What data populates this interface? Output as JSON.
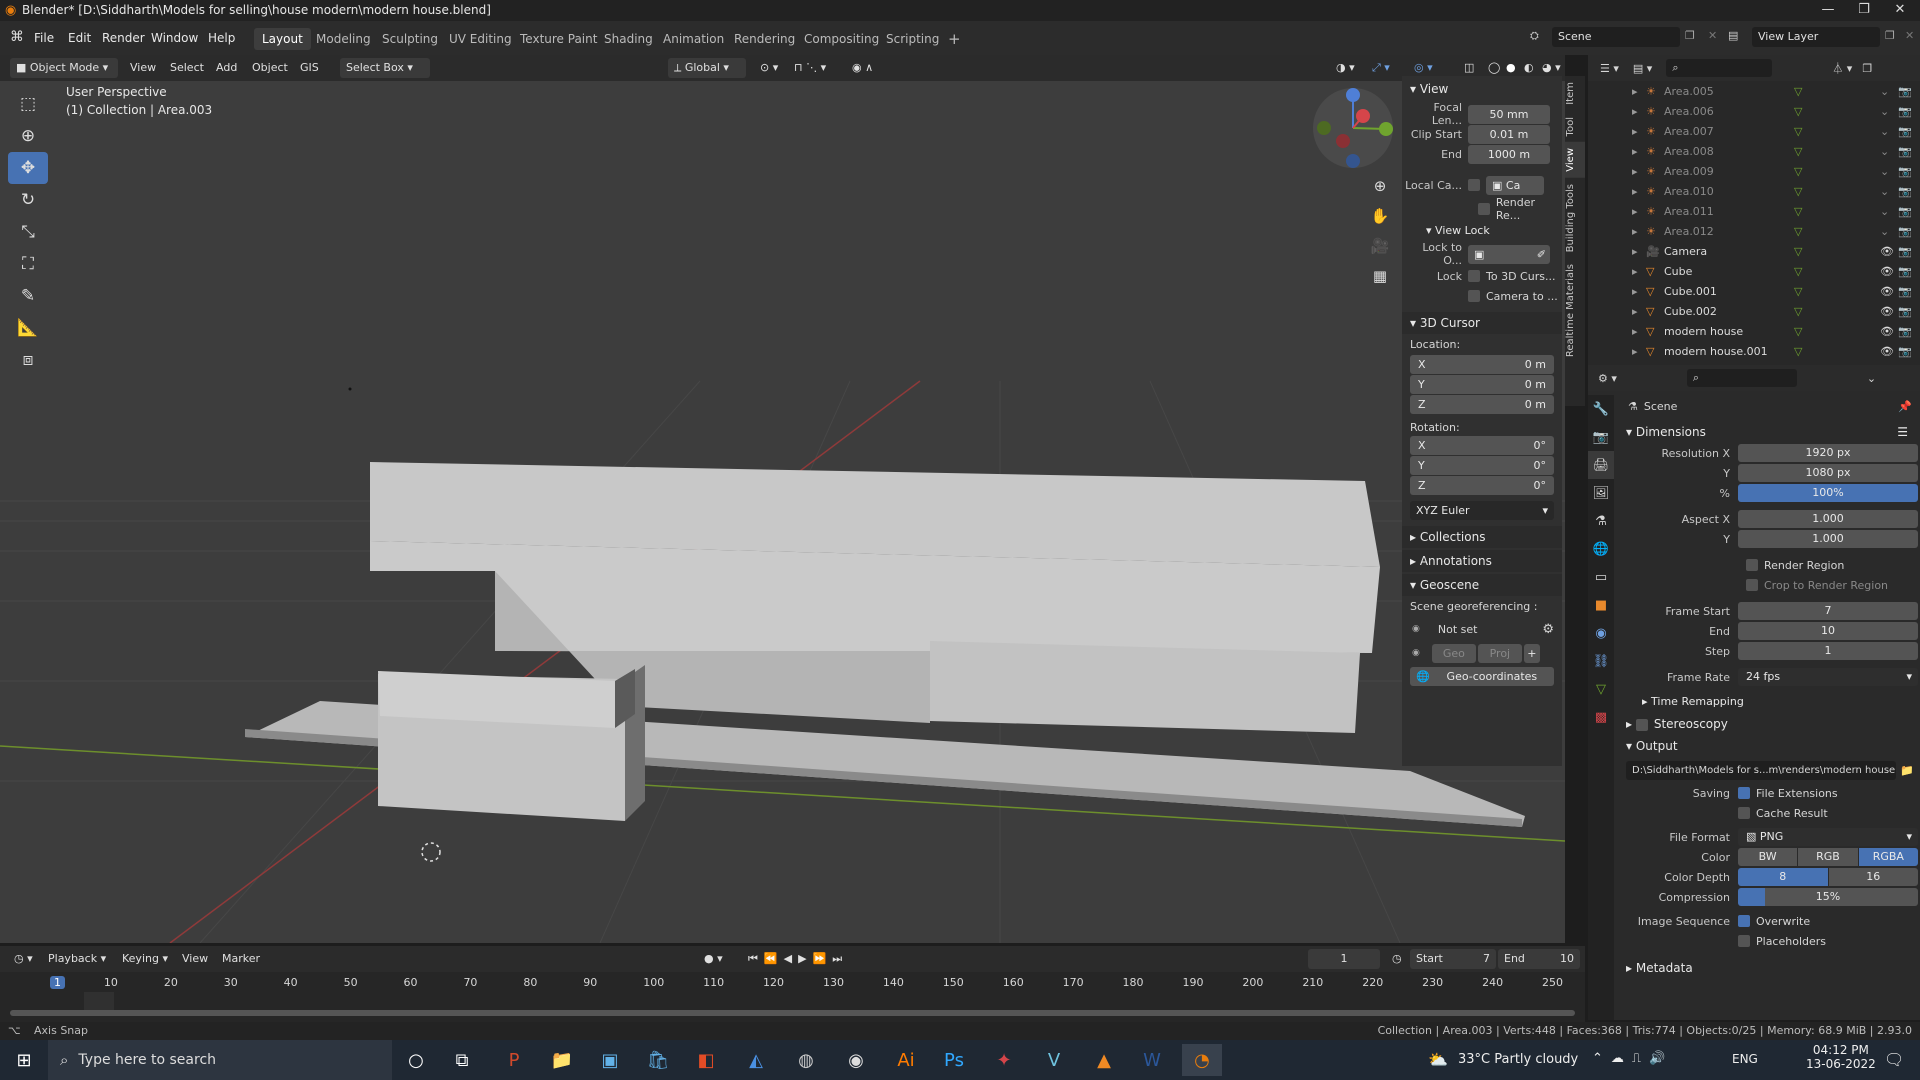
{
  "window": {
    "title": "Blender* [D:\\Siddharth\\Models for selling\\house modern\\modern house.blend]"
  },
  "menu": [
    "File",
    "Edit",
    "Render",
    "Window",
    "Help"
  ],
  "workspaces": [
    "Layout",
    "Modeling",
    "Sculpting",
    "UV Editing",
    "Texture Paint",
    "Shading",
    "Animation",
    "Rendering",
    "Compositing",
    "Scripting"
  ],
  "active_workspace": "Layout",
  "scene_name": "Scene",
  "view_layer": "View Layer",
  "viewport_header": {
    "mode": "Object Mode",
    "menus": [
      "View",
      "Select",
      "Add",
      "Object",
      "GIS"
    ],
    "select_box": "Select Box",
    "transform": "Global"
  },
  "viewport": {
    "perspective": "User Perspective",
    "collection_info": "(1) Collection | Area.003"
  },
  "npanel": {
    "tabs": [
      "Item",
      "Tool",
      "View",
      "Building Tools",
      "Realtime Materials"
    ],
    "view_header": "View",
    "focal_label": "Focal Len...",
    "focal_value": "50 mm",
    "clip_start_label": "Clip Start",
    "clip_start_value": "0.01 m",
    "clip_end_label": "End",
    "clip_end_value": "1000 m",
    "local_camera_label": "Local Ca...",
    "local_camera_value": "Ca",
    "render_region": "Render Re...",
    "view_lock_header": "View Lock",
    "lock_to_label": "Lock to O...",
    "lock_label": "Lock",
    "lock_cursor": "To 3D Curs...",
    "lock_camera": "Camera to ...",
    "cursor_header": "3D Cursor",
    "location_label": "Location:",
    "loc_x": "0 m",
    "loc_y": "0 m",
    "loc_z": "0 m",
    "rotation_label": "Rotation:",
    "rot_x": "0°",
    "rot_y": "0°",
    "rot_z": "0°",
    "rotation_mode": "XYZ Euler",
    "collections": "Collections",
    "annotations": "Annotations",
    "geoscene": "Geoscene",
    "georef_label": "Scene georeferencing :",
    "not_set": "Not set",
    "geo": "Geo",
    "proj": "Proj",
    "geo_coords": "Geo-coordinates"
  },
  "outliner": {
    "items": [
      {
        "name": "Area.005",
        "type": "light",
        "dim": true
      },
      {
        "name": "Area.006",
        "type": "light",
        "dim": true
      },
      {
        "name": "Area.007",
        "type": "light",
        "dim": true
      },
      {
        "name": "Area.008",
        "type": "light",
        "dim": true
      },
      {
        "name": "Area.009",
        "type": "light",
        "dim": true
      },
      {
        "name": "Area.010",
        "type": "light",
        "dim": true
      },
      {
        "name": "Area.011",
        "type": "light",
        "dim": true
      },
      {
        "name": "Area.012",
        "type": "light",
        "dim": true
      },
      {
        "name": "Camera",
        "type": "camera",
        "dim": false
      },
      {
        "name": "Cube",
        "type": "mesh",
        "dim": false
      },
      {
        "name": "Cube.001",
        "type": "mesh",
        "dim": false
      },
      {
        "name": "Cube.002",
        "type": "mesh",
        "dim": false
      },
      {
        "name": "modern house",
        "type": "mesh",
        "dim": false
      },
      {
        "name": "modern house.001",
        "type": "mesh",
        "dim": false
      }
    ]
  },
  "properties": {
    "context": "Scene",
    "dimensions_header": "Dimensions",
    "res_x_label": "Resolution X",
    "res_x": "1920 px",
    "res_y_label": "Y",
    "res_y": "1080 px",
    "res_pct_label": "%",
    "res_pct": "100%",
    "aspect_x_label": "Aspect X",
    "aspect_x": "1.000",
    "aspect_y_label": "Y",
    "aspect_y": "1.000",
    "render_region": "Render Region",
    "crop_region": "Crop to Render Region",
    "frame_start_label": "Frame Start",
    "frame_start": "7",
    "frame_end_label": "End",
    "frame_end": "10",
    "frame_step_label": "Step",
    "frame_step": "1",
    "frame_rate_label": "Frame Rate",
    "frame_rate": "24 fps",
    "time_remapping": "Time Remapping",
    "stereoscopy": "Stereoscopy",
    "output_header": "Output",
    "output_path": "D:\\Siddharth\\Models for s...m\\renders\\modern house",
    "saving_label": "Saving",
    "file_extensions": "File Extensions",
    "cache_result": "Cache Result",
    "file_format_label": "File Format",
    "file_format": "PNG",
    "color_label": "Color",
    "color_bw": "BW",
    "color_rgb": "RGB",
    "color_rgba": "RGBA",
    "color_depth_label": "Color Depth",
    "depth_8": "8",
    "depth_16": "16",
    "compression_label": "Compression",
    "compression": "15%",
    "image_seq_label": "Image Sequence",
    "overwrite": "Overwrite",
    "placeholders": "Placeholders",
    "metadata": "Metadata"
  },
  "timeline": {
    "menus": [
      "Playback",
      "Keying",
      "View",
      "Marker"
    ],
    "current_frame": "1",
    "start_label": "Start",
    "start": "7",
    "end_label": "End",
    "end": "10",
    "ticks": [
      "1",
      "10",
      "20",
      "30",
      "40",
      "50",
      "60",
      "70",
      "80",
      "90",
      "100",
      "110",
      "120",
      "130",
      "140",
      "150",
      "160",
      "170",
      "180",
      "190",
      "200",
      "210",
      "220",
      "230",
      "240",
      "250"
    ]
  },
  "status": {
    "left": "Axis Snap",
    "right": "Collection | Area.003 | Verts:448 | Faces:368 | Tris:774 | Objects:0/25 | Memory: 68.9 MiB | 2.93.0"
  },
  "taskbar": {
    "search_placeholder": "Type here to search",
    "weather": "33°C  Partly cloudy",
    "lang": "ENG",
    "time": "04:12 PM",
    "date": "13-06-2022"
  }
}
